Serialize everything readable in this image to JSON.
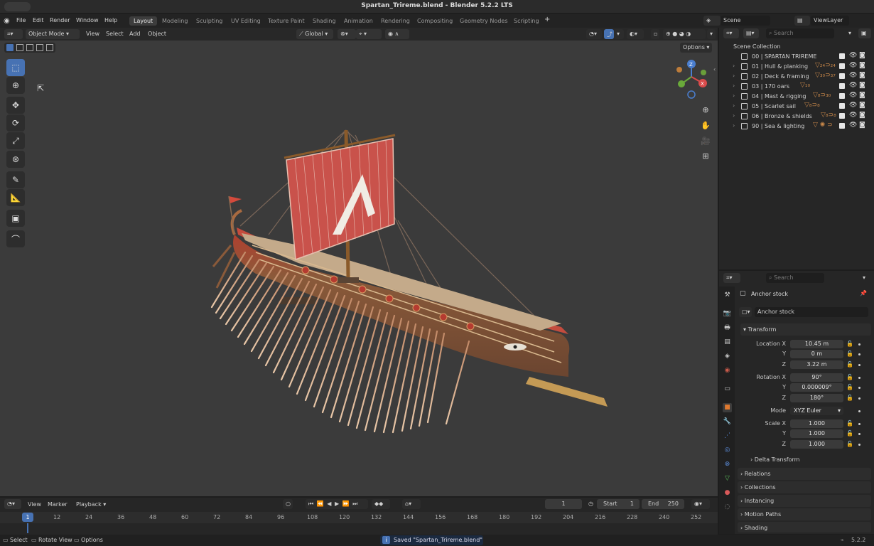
{
  "window": {
    "title": "Spartan_Trireme.blend - Blender 5.2.2 LTS"
  },
  "menu": [
    "File",
    "Edit",
    "Render",
    "Window",
    "Help"
  ],
  "workspaces": [
    {
      "label": "Layout",
      "active": true
    },
    {
      "label": "Modeling"
    },
    {
      "label": "Sculpting"
    },
    {
      "label": "UV Editing"
    },
    {
      "label": "Texture Paint"
    },
    {
      "label": "Shading"
    },
    {
      "label": "Animation"
    },
    {
      "label": "Rendering"
    },
    {
      "label": "Compositing"
    },
    {
      "label": "Geometry Nodes"
    },
    {
      "label": "Scripting"
    }
  ],
  "top_right": {
    "scene": "Scene",
    "view_layer": "ViewLayer"
  },
  "viewport_header": {
    "mode": "Object Mode",
    "menus": [
      "View",
      "Select",
      "Add",
      "Object"
    ],
    "orientation": "Global",
    "options": "Options"
  },
  "toolbar_icons": [
    "select-box-icon",
    "cursor-icon",
    "move-icon",
    "rotate-icon",
    "scale-icon",
    "transform-icon",
    "annotate-icon",
    "measure-icon",
    "add-cube-icon",
    "curve-icon"
  ],
  "outliner": {
    "search_placeholder": "Search",
    "root": "Scene Collection",
    "rows": [
      {
        "label": "00 | SPARTAN TRIREME",
        "expand": false,
        "filters": ""
      },
      {
        "label": "01 | Hull & planking",
        "expand": true,
        "filters": "▽₂₄⊃₂₄"
      },
      {
        "label": "02 | Deck & framing",
        "expand": true,
        "filters": "▽₃₀⊃₃₇"
      },
      {
        "label": "03 | 170 oars",
        "expand": true,
        "filters": "▽₁₀"
      },
      {
        "label": "04 | Mast & rigging",
        "expand": true,
        "filters": "▽₈⊃₃₀"
      },
      {
        "label": "05 | Scarlet sail",
        "expand": true,
        "filters": "▽₈⊃₈"
      },
      {
        "label": "06 | Bronze & shields",
        "expand": true,
        "filters": "▽₈⊃₈"
      },
      {
        "label": "90 | Sea & lighting",
        "expand": true,
        "filters": "▽ ✺ ⊃"
      }
    ]
  },
  "properties": {
    "search_placeholder": "Search",
    "object_name": "Anchor stock",
    "data_name": "Anchor stock",
    "transform_title": "Transform",
    "location_label": "Location X",
    "location": [
      "10.45 m",
      "0 m",
      "3.22 m"
    ],
    "rotation_label": "Rotation X",
    "rotation": [
      "90°",
      "0.000009°",
      "180°"
    ],
    "mode_label": "Mode",
    "mode": "XYZ Euler",
    "scale_label": "Scale X",
    "scale": [
      "1.000",
      "1.000",
      "1.000"
    ],
    "y_label": "Y",
    "z_label": "Z",
    "delta": "Delta Transform",
    "sections": [
      "Relations",
      "Collections",
      "Instancing",
      "Motion Paths",
      "Shading"
    ]
  },
  "timeline": {
    "menus": [
      "View",
      "Marker",
      "Playback"
    ],
    "current_frame": "1",
    "start_label": "Start",
    "start": "1",
    "end_label": "End",
    "end": "250",
    "ticks": [
      "1",
      "12",
      "24",
      "36",
      "48",
      "60",
      "72",
      "84",
      "96",
      "108",
      "120",
      "132",
      "144",
      "156",
      "168",
      "180",
      "192",
      "204",
      "216",
      "228",
      "240",
      "252"
    ]
  },
  "statusbar": {
    "select": "Select",
    "rotate": "Rotate View",
    "options": "Options",
    "message": "Saved \"Spartan_Trireme.blend\"",
    "version": "5.2.2"
  },
  "colors": {
    "accent": "#4772b3",
    "sail": "#c9524b",
    "hull_wood": "#8a5a3a",
    "deck": "#c4aa8a",
    "viewport_bg": "#3b3b3b"
  }
}
